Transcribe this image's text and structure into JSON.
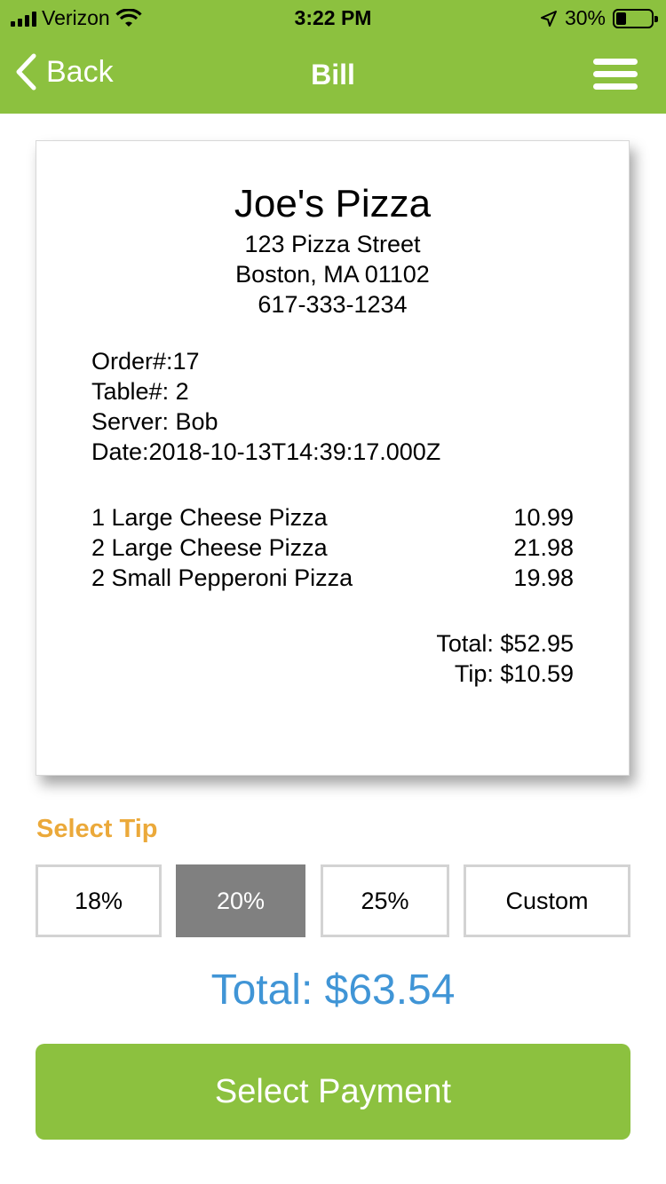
{
  "status_bar": {
    "carrier": "Verizon",
    "time": "3:22 PM",
    "battery_text": "30%",
    "battery_level": 0.3,
    "icons": [
      "signal-bars-icon",
      "wifi-icon",
      "location-arrow-icon",
      "battery-icon"
    ]
  },
  "navbar": {
    "back_label": "Back",
    "title": "Bill",
    "menu_icon": "hamburger-menu-icon",
    "back_icon": "chevron-left-icon"
  },
  "receipt": {
    "store_name": "Joe's Pizza",
    "address_line1": "123 Pizza Street",
    "address_line2": "Boston, MA 01102",
    "phone": "617-333-1234",
    "order": "Order#:17",
    "table": "Table#: 2",
    "server": "Server: Bob",
    "date": "Date:2018-10-13T14:39:17.000Z",
    "items": [
      {
        "name": "1 Large Cheese Pizza",
        "price": "10.99"
      },
      {
        "name": "2 Large Cheese Pizza",
        "price": "21.98"
      },
      {
        "name": "2 Small Pepperoni Pizza",
        "price": "19.98"
      }
    ],
    "total": "Total: $52.95",
    "tip": "Tip: $10.59"
  },
  "tip_selector": {
    "heading": "Select Tip",
    "options": [
      "18%",
      "20%",
      "25%",
      "Custom"
    ],
    "selected": "20%"
  },
  "grand_total": "Total: $63.54",
  "payment_button": "Select Payment",
  "colors": {
    "brand_green": "#8cc13f",
    "tip_heading_orange": "#eba93a",
    "total_blue": "#4095d6",
    "selected_gray": "#808080"
  }
}
